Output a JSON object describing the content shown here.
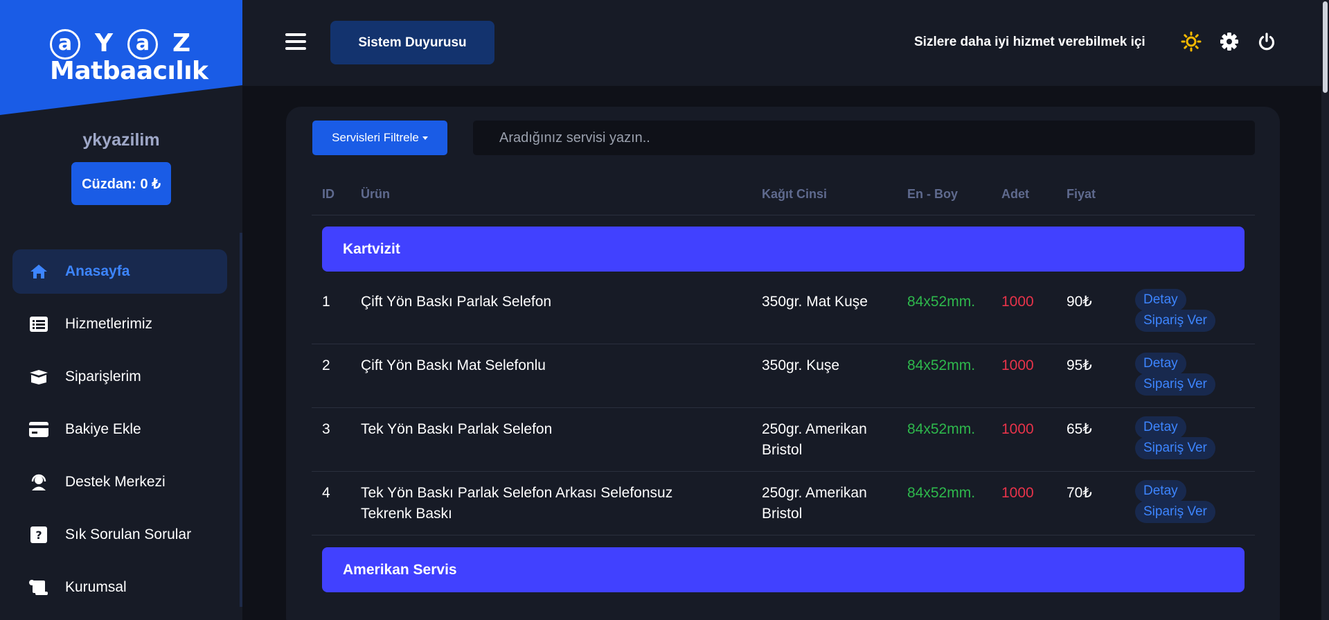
{
  "brand": {
    "logo_letters": [
      "a",
      "Y",
      "a",
      "Z"
    ],
    "logo_sub": "Matbaacılık"
  },
  "user": {
    "name": "ykyazilim",
    "wallet": "Cüzdan: 0 ₺"
  },
  "sidebar": {
    "items": [
      {
        "label": "Anasayfa",
        "icon": "home-icon",
        "active": true
      },
      {
        "label": "Hizmetlerimiz",
        "icon": "list-icon"
      },
      {
        "label": "Siparişlerim",
        "icon": "box-icon"
      },
      {
        "label": "Bakiye Ekle",
        "icon": "credit-card-icon"
      },
      {
        "label": "Destek Merkezi",
        "icon": "headset-icon"
      },
      {
        "label": "Sık Sorulan Sorular",
        "icon": "question-icon"
      },
      {
        "label": "Kurumsal",
        "icon": "scroll-icon"
      }
    ]
  },
  "header": {
    "announce_label": "Sistem Duyurusu",
    "marquee_text": "Sizlere daha iyi hizmet verebilmek için"
  },
  "toolbar": {
    "filter_label": "Servisleri Filtrele",
    "search_placeholder": "Aradığınız servisi yazın.."
  },
  "table": {
    "headers": {
      "id": "ID",
      "product": "Ürün",
      "paper": "Kağıt Cinsi",
      "size": "En - Boy",
      "qty": "Adet",
      "price": "Fiyat"
    },
    "categories": [
      {
        "name": "Kartvizit",
        "rows": [
          {
            "id": "1",
            "product": "Çift Yön Baskı Parlak Selefon",
            "paper": "350gr. Mat Kuşe",
            "size": "84x52mm.",
            "qty": "1000",
            "price": "90₺",
            "detail": "Detay",
            "order": "Sipariş Ver"
          },
          {
            "id": "2",
            "product": "Çift Yön Baskı Mat Selefonlu",
            "paper": "350gr. Kuşe",
            "size": "84x52mm.",
            "qty": "1000",
            "price": "95₺",
            "detail": "Detay",
            "order": "Sipariş Ver"
          },
          {
            "id": "3",
            "product": "Tek Yön Baskı Parlak Selefon",
            "paper": "250gr. Amerikan Bristol",
            "size": "84x52mm.",
            "qty": "1000",
            "price": "65₺",
            "detail": "Detay",
            "order": "Sipariş Ver"
          },
          {
            "id": "4",
            "product": "Tek Yön Baskı Parlak Selefon Arkası Selefonsuz Tekrenk Baskı",
            "paper": "250gr. Amerikan Bristol",
            "size": "84x52mm.",
            "qty": "1000",
            "price": "70₺",
            "detail": "Detay",
            "order": "Sipariş Ver"
          }
        ]
      },
      {
        "name": "Amerikan Servis",
        "rows": []
      }
    ]
  },
  "colors": {
    "accent": "#1a5ce6",
    "category": "#4141ff",
    "size": "#2eb84c",
    "qty": "#e8334a",
    "sun": "#f5b800"
  }
}
